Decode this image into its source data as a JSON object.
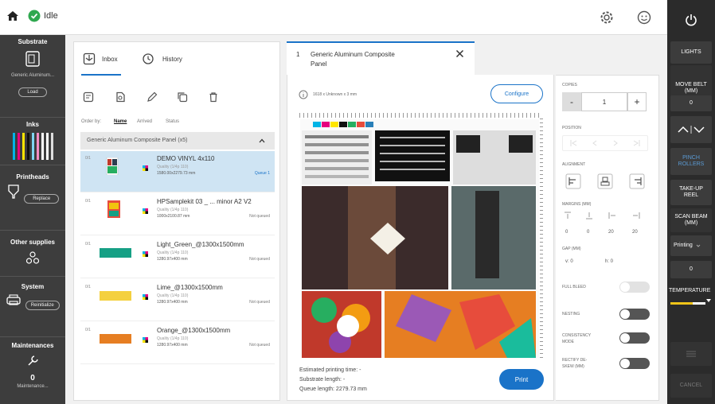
{
  "topbar": {
    "status": "Idle"
  },
  "left_sidebar": {
    "substrate": {
      "title": "Substrate",
      "sub": "Generic Aluminum...",
      "button": "Load"
    },
    "inks": {
      "title": "Inks"
    },
    "printheads": {
      "title": "Printheads",
      "button": "Replace"
    },
    "other": {
      "title": "Other supplies"
    },
    "system": {
      "title": "System",
      "button": "Reinitialize"
    },
    "maintenance": {
      "title": "Maintenances",
      "count": "0",
      "sub": "Maintenance..."
    }
  },
  "queue": {
    "tabs": {
      "inbox": "Inbox",
      "history": "History"
    },
    "order": {
      "label": "Order by:",
      "name": "Name",
      "arrived": "Arrived",
      "status": "Status"
    },
    "group": "Generic Aluminum Composite Panel (x5)",
    "jobs": [
      {
        "idx": "0/1",
        "name": "DEMO VINYL 4x110",
        "l1": "Quality (1/4p 110)",
        "l2": "1580.00x2279.73 mm",
        "status": "Queue 1"
      },
      {
        "idx": "0/1",
        "name": "HPSamplekit 03 _ ... minor A2 V2",
        "l1": "Quality (1/4p 110)",
        "l2": "1000x2100.87 mm",
        "status": "Not queued"
      },
      {
        "idx": "0/1",
        "name": "Light_Green_@1300x1500mm",
        "l1": "Quality (1/4p 110)",
        "l2": "1280.97x400 mm",
        "status": "Not queued"
      },
      {
        "idx": "0/1",
        "name": "Lime_@1300x1500mm",
        "l1": "Quality (1/4p 110)",
        "l2": "1280.97x400 mm",
        "status": "Not queued"
      },
      {
        "idx": "0/1",
        "name": "Orange_@1300x1500mm",
        "l1": "Quality (1/4p 110)",
        "l2": "1280.97x400 mm",
        "status": "Not queued"
      }
    ]
  },
  "job": {
    "tab_index": "1",
    "tab_title": "Generic Aluminum Composite",
    "tab_title2": "Panel",
    "size": "1618 x Unknown x 3 mm",
    "configure": "Configure",
    "est_time": "Estimated printing time: -",
    "substrate_len": "Substrate length: -",
    "queue_len": "Queue length: 2279.73 mm",
    "print": "Print"
  },
  "settings": {
    "copies_label": "COPIES",
    "copies_minus": "-",
    "copies_value": "1",
    "copies_plus": "+",
    "position_label": "POSITION",
    "alignment_label": "ALIGNMENT",
    "margins_label": "MARGINS (MM)",
    "margins": [
      "0",
      "0",
      "20",
      "20"
    ],
    "gap_label": "GAP (MM)",
    "gap_v": "v: 0",
    "gap_h": "h: 0",
    "full_bleed": "FULL BLEED",
    "nesting": "NESTING",
    "consistency": "CONSISTENCY",
    "consistency2": "MODE",
    "rectify": "RECTIFY DE-",
    "rectify2": "SKEW (MM)"
  },
  "right_sidebar": {
    "lights": "LIGHTS",
    "move_belt": "MOVE BELT",
    "move_belt2": "(MM)",
    "move_value": "0",
    "pinch": "PINCH",
    "pinch2": "ROLLERS",
    "takeup": "TAKE-UP",
    "takeup2": "REEL",
    "scan": "SCAN BEAM",
    "scan2": "(MM)",
    "printing": "Printing",
    "scan_value": "0",
    "temperature": "TEMPERATURE",
    "cancel": "CANCEL"
  },
  "colors": {
    "accent": "#1a73c8",
    "sidebar": "#3d3d3d",
    "selected": "#cfe4f3",
    "ok": "#2fa84f"
  }
}
